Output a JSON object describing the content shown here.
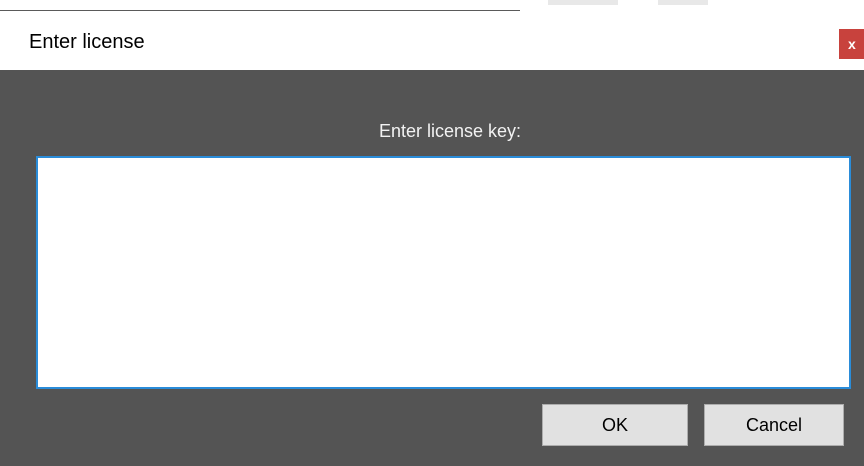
{
  "dialog": {
    "title": "Enter license",
    "close_label": "x",
    "prompt": "Enter license key:",
    "license_value": "",
    "ok_label": "OK",
    "cancel_label": "Cancel"
  },
  "colors": {
    "panel_background": "#545454",
    "close_button": "#c8423d",
    "input_border": "#2a8cd9",
    "button_background": "#e1e1e1"
  }
}
